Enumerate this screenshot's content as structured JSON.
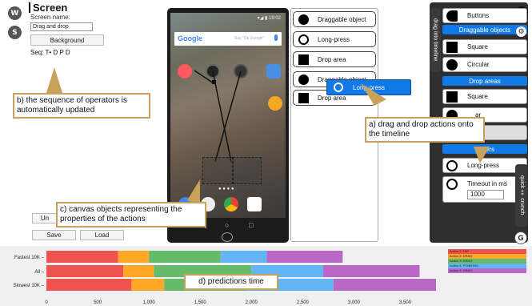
{
  "left_panel": {
    "w_button": "W",
    "s_button": "S",
    "screen_title": "Screen",
    "screen_name_label": "Screen name:",
    "screen_name_value": "Drag and drop",
    "background_button": "Background",
    "sequence_label": "Seq: T• D P D",
    "undo_label": "Un",
    "save_label": "Save",
    "load_label": "Load"
  },
  "phone": {
    "status_time": "19:02",
    "search_brand": "Google",
    "search_placeholder": "Say \"Ok Google\""
  },
  "palette": {
    "items": [
      {
        "label": "Draggable object",
        "icon": "filled-circle-icon"
      },
      {
        "label": "Long-press",
        "icon": "long-press-icon"
      },
      {
        "label": "Drop area",
        "icon": "filled-square-icon"
      },
      {
        "label": "Draggable object",
        "icon": "filled-circle-icon"
      },
      {
        "label": "Drop area",
        "icon": "filled-square-icon"
      }
    ],
    "dragging_label": "Long-press"
  },
  "right_panel": {
    "vertical_tab": "drag into timeline",
    "help_label": "?",
    "buttons_label": "Buttons",
    "draggable_header": "Draggable objects",
    "square_label": "Square",
    "circular_label": "Circular",
    "drop_header": "Drop areas",
    "drop_square_label": "Square",
    "partial_label_1": "ar",
    "partial_label_2": "es",
    "timers_header": "Timers",
    "longpress_label": "Long-press",
    "timeout_label": "Timeout in ms",
    "timeout_value": "1000",
    "quick_tab": "quick ⁑ crunch",
    "g_label": "G"
  },
  "annotations": {
    "a": "a) drag and drop actions onto the timeline",
    "b": "b) the sequence of operators is automatically updated",
    "c": "c) canvas objects representing the properties of the actions",
    "d": "d) predictions time"
  },
  "colors": {
    "red": "#ef5350",
    "orange": "#ffa726",
    "green": "#66bb6a",
    "blue": "#64b5f6",
    "purple": "#ba68c8",
    "accent": "#1178e8",
    "callout_border": "#c9a15a"
  },
  "chart_data": {
    "type": "bar",
    "orientation": "horizontal",
    "stacked": true,
    "categories": [
      "Fastest 10K",
      "All",
      "Slowest 10K"
    ],
    "series": [
      {
        "name": "Action 1: TAP",
        "values": [
          700,
          750,
          830
        ]
      },
      {
        "name": "Action 2: DRAG",
        "values": [
          300,
          300,
          320
        ]
      },
      {
        "name": "Action 3: DRAG",
        "values": [
          700,
          950,
          800
        ]
      },
      {
        "name": "Action 4: POINTING",
        "values": [
          450,
          700,
          850
        ]
      },
      {
        "name": "Action 5: DRAG",
        "values": [
          740,
          940,
          1000
        ]
      }
    ],
    "xticks": [
      "0",
      "500",
      "1,000",
      "1,500",
      "2,000",
      "2,500",
      "3,000",
      "3,500"
    ],
    "xlim": [
      0,
      3800
    ],
    "legend": "top-right"
  }
}
